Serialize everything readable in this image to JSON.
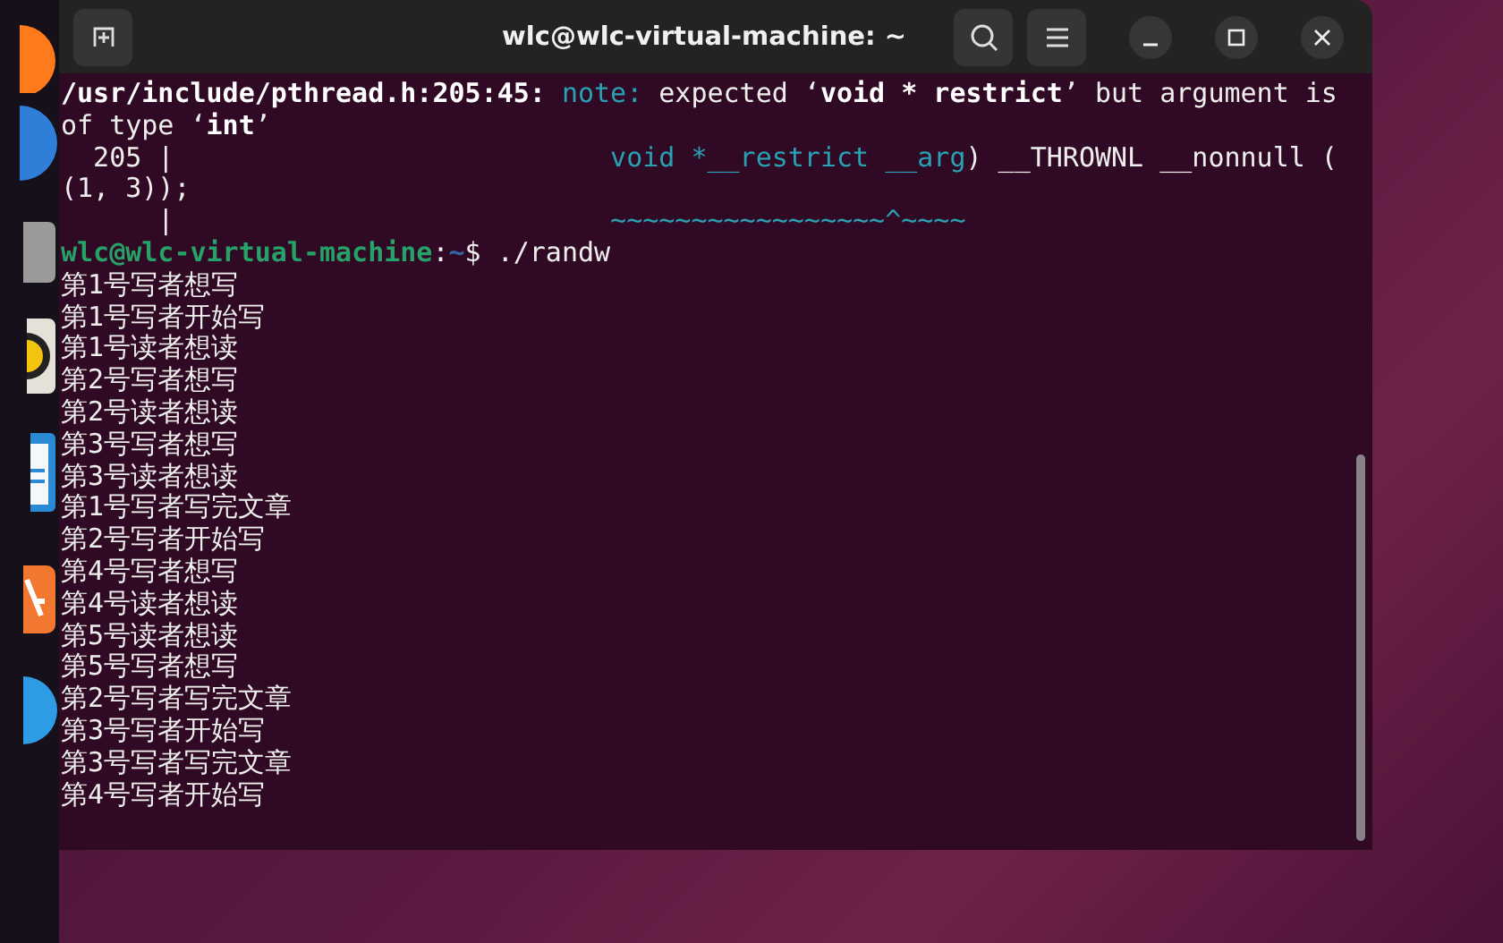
{
  "window": {
    "title": "wlc@wlc-virtual-machine: ~"
  },
  "terminal": {
    "lines": [
      {
        "segments": [
          {
            "kind": "bold",
            "text": "/usr/include/pthread.h:205:45:"
          },
          {
            "kind": "note",
            "text": " note:"
          },
          {
            "kind": "plain",
            "text": " expected ‘"
          },
          {
            "kind": "bold",
            "text": "void * restrict"
          },
          {
            "kind": "plain",
            "text": "’ but argument is"
          }
        ]
      },
      {
        "segments": [
          {
            "kind": "plain",
            "text": "of type ‘"
          },
          {
            "kind": "bold",
            "text": "int"
          },
          {
            "kind": "plain",
            "text": "’"
          }
        ]
      },
      {
        "segments": [
          {
            "kind": "plain",
            "text": "  205 |                           "
          },
          {
            "kind": "note",
            "text": "void *__restrict __arg"
          },
          {
            "kind": "plain",
            "text": ") __THROWNL __nonnull ("
          }
        ]
      },
      {
        "segments": [
          {
            "kind": "plain",
            "text": "(1, 3));"
          }
        ]
      },
      {
        "segments": [
          {
            "kind": "plain",
            "text": "      |                           "
          },
          {
            "kind": "note",
            "text": "~~~~~~~~~~~~~~~~~^~~~~"
          }
        ]
      },
      {
        "segments": [
          {
            "kind": "user",
            "text": "wlc@wlc-virtual-machine"
          },
          {
            "kind": "plain",
            "text": ":"
          },
          {
            "kind": "path",
            "text": "~"
          },
          {
            "kind": "plain",
            "text": "$ ./randw"
          }
        ]
      },
      {
        "segments": [
          {
            "kind": "plain",
            "text": "第1号写者想写"
          }
        ]
      },
      {
        "segments": [
          {
            "kind": "plain",
            "text": "第1号写者开始写"
          }
        ]
      },
      {
        "segments": [
          {
            "kind": "plain",
            "text": "第1号读者想读"
          }
        ]
      },
      {
        "segments": [
          {
            "kind": "plain",
            "text": "第2号写者想写"
          }
        ]
      },
      {
        "segments": [
          {
            "kind": "plain",
            "text": "第2号读者想读"
          }
        ]
      },
      {
        "segments": [
          {
            "kind": "plain",
            "text": "第3号写者想写"
          }
        ]
      },
      {
        "segments": [
          {
            "kind": "plain",
            "text": "第3号读者想读"
          }
        ]
      },
      {
        "segments": [
          {
            "kind": "plain",
            "text": "第1号写者写完文章"
          }
        ]
      },
      {
        "segments": [
          {
            "kind": "plain",
            "text": "第2号写者开始写"
          }
        ]
      },
      {
        "segments": [
          {
            "kind": "plain",
            "text": "第4号写者想写"
          }
        ]
      },
      {
        "segments": [
          {
            "kind": "plain",
            "text": "第4号读者想读"
          }
        ]
      },
      {
        "segments": [
          {
            "kind": "plain",
            "text": "第5号读者想读"
          }
        ]
      },
      {
        "segments": [
          {
            "kind": "plain",
            "text": "第5号写者想写"
          }
        ]
      },
      {
        "segments": [
          {
            "kind": "plain",
            "text": "第2号写者写完文章"
          }
        ]
      },
      {
        "segments": [
          {
            "kind": "plain",
            "text": "第3号写者开始写"
          }
        ]
      },
      {
        "segments": [
          {
            "kind": "plain",
            "text": "第3号写者写完文章"
          }
        ]
      },
      {
        "segments": [
          {
            "kind": "plain",
            "text": "第4号写者开始写"
          }
        ]
      }
    ]
  }
}
